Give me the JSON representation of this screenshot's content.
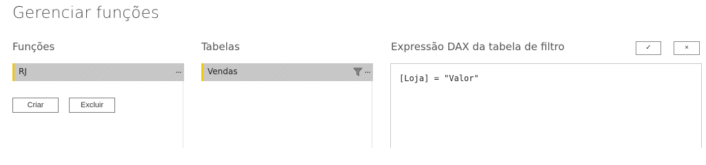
{
  "page": {
    "title": "Gerenciar funções"
  },
  "roles": {
    "heading": "Funções",
    "items": [
      {
        "label": "RJ",
        "more": "..."
      }
    ],
    "create_label": "Criar",
    "delete_label": "Excluir"
  },
  "tables": {
    "heading": "Tabelas",
    "items": [
      {
        "label": "Vendas",
        "more": "...",
        "icon": "filter-icon"
      }
    ]
  },
  "dax": {
    "heading": "Expressão DAX da tabela de filtro",
    "expression": "[Loja] = \"Valor\"",
    "confirm_icon": "✓",
    "cancel_icon": "×"
  },
  "colors": {
    "accent": "#f2c811",
    "selected_row": "#c8c8c8"
  }
}
